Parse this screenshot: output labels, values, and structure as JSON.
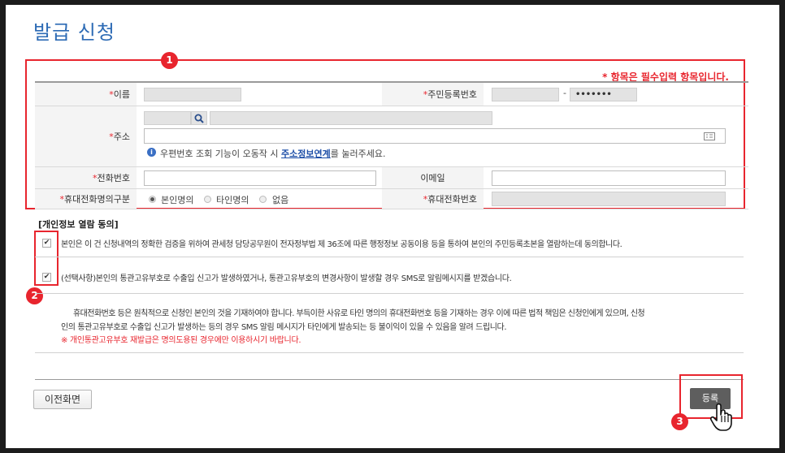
{
  "page_title": "발급 신청",
  "required_note": "* 항목은 필수입력 항목입니다.",
  "badges": {
    "b1": "1",
    "b2": "2",
    "b3": "3"
  },
  "form": {
    "name_label": "이름",
    "rrn_label": "주민등록번호",
    "rrn_separator": "-",
    "rrn_masked": "•••••••",
    "address_label": "주소",
    "address_hint_prefix": "우편번호 조회 기능이 오동작 시 ",
    "address_hint_link": "주소정보연계",
    "address_hint_suffix": "를 눌러주세요.",
    "phone_label": "전화번호",
    "email_label": "이메일",
    "mobile_type_label": "휴대전화명의구분",
    "mobile_type_options": [
      "본인명의",
      "타인명의",
      "없음"
    ],
    "mobile_label": "휴대전화번호"
  },
  "consent": {
    "title": "[개인정보 열람 동의]",
    "item1": "본인은 이 건 신청내역의 정확한 검증을 위하여 관세청 담당공무원이 전자정부법 제 36조에 따른 행정정보 공동이용 등을 통하여 본인의 주민등록초본을 열람하는데 동의합니다.",
    "item2": "(선택사항)본인의 통관고유부호로 수출입 신고가 발생하였거나, 통관고유부호의 변경사항이 발생할 경우 SMS로 알림메시지를 받겠습니다.",
    "notice_line1": "휴대전화번호 등은 원칙적으로 신청인 본인의 것을 기재하여야 합니다. 부득이한 사유로 타인 명의의 휴대전화번호 등을 기재하는 경우 이에 따른 법적 책임은 신청인에게 있으며, 신청",
    "notice_line2": "인의 통관고유부호로 수출입 신고가 발생하는 등의 경우 SMS 알림 메시지가 타인에게 발송되는 등 불이익이 있을 수 있음을 알려 드립니다.",
    "notice_red": "※ 개인통관고유부호 재발급은 명의도용된 경우에만 이용하시기 바랍니다."
  },
  "buttons": {
    "back": "이전화면",
    "register": "등록"
  },
  "colors": {
    "accent_red": "#e8252e",
    "title_blue": "#2d6bb5",
    "link_blue": "#1e4fa8"
  }
}
